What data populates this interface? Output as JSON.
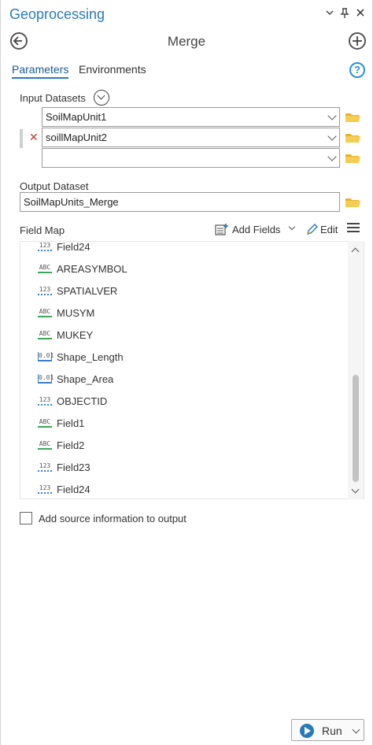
{
  "window": {
    "title": "Geoprocessing",
    "controls": [
      "chevron-down-icon",
      "pin-icon",
      "close-icon"
    ]
  },
  "tool": {
    "title": "Merge"
  },
  "tabs": [
    {
      "label": "Parameters",
      "active": true
    },
    {
      "label": "Environments",
      "active": false
    }
  ],
  "help_label": "?",
  "input_datasets": {
    "label": "Input Datasets",
    "rows": [
      {
        "value": "SoilMapUnit1"
      },
      {
        "value": "soillMapUnit2"
      },
      {
        "value": ""
      }
    ]
  },
  "output_dataset": {
    "label": "Output Dataset",
    "value": "SoilMapUnits_Merge"
  },
  "field_map": {
    "label": "Field Map",
    "add_fields_label": "Add Fields",
    "edit_label": "Edit",
    "fields": [
      {
        "name": "Field24",
        "type": "123"
      },
      {
        "name": "AREASYMBOL",
        "type": "ABC"
      },
      {
        "name": "SPATIALVER",
        "type": "123"
      },
      {
        "name": "MUSYM",
        "type": "ABC"
      },
      {
        "name": "MUKEY",
        "type": "ABC"
      },
      {
        "name": "Shape_Length",
        "type": "0.01"
      },
      {
        "name": "Shape_Area",
        "type": "0.01"
      },
      {
        "name": "OBJECTID",
        "type": "123"
      },
      {
        "name": "Field1",
        "type": "ABC"
      },
      {
        "name": "Field2",
        "type": "ABC"
      },
      {
        "name": "Field23",
        "type": "123"
      },
      {
        "name": "Field24",
        "type": "123"
      }
    ]
  },
  "add_source_info": {
    "label": "Add source information to output",
    "checked": false
  },
  "run_button": {
    "label": "Run"
  },
  "colors": {
    "accent": "#2a7ab8",
    "folder": "#e9b32a",
    "remove": "#c0392b",
    "text_type": "#39a85b",
    "number_type": "#3a7dc5"
  }
}
